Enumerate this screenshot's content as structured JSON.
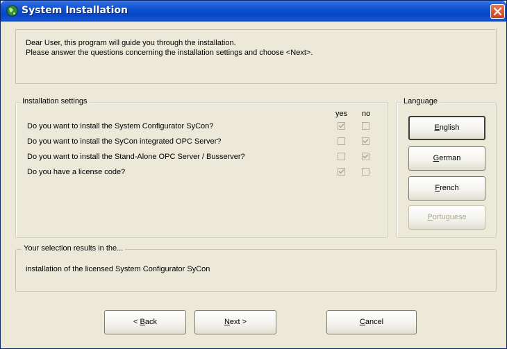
{
  "window": {
    "title": "System Installation",
    "icon": "globe-icon",
    "close_icon": "close-icon"
  },
  "intro": {
    "line1": "Dear User, this program will guide you through the installation.",
    "line2": "Please answer the questions concerning the installation settings and choose <Next>."
  },
  "settings": {
    "group_label": "Installation settings",
    "yes_header": "yes",
    "no_header": "no",
    "questions": [
      {
        "text": "Do you want to install the System Configurator SyCon?",
        "yes": true,
        "no": false
      },
      {
        "text": "Do you want to install the SyCon integrated OPC Server?",
        "yes": false,
        "no": true
      },
      {
        "text": "Do you want to install the Stand-Alone OPC Server / Busserver?",
        "yes": false,
        "no": true
      },
      {
        "text": "Do you have a license code?",
        "yes": true,
        "no": false
      }
    ]
  },
  "language": {
    "group_label": "Language",
    "buttons": [
      {
        "label": "English",
        "hotkey": "E",
        "rest": "nglish",
        "state": "selected"
      },
      {
        "label": "German",
        "hotkey": "G",
        "rest": "erman",
        "state": "enabled"
      },
      {
        "label": "French",
        "hotkey": "F",
        "rest": "rench",
        "state": "enabled"
      },
      {
        "label": "Portuguese",
        "hotkey": "P",
        "rest": "ortuguese",
        "state": "disabled"
      }
    ]
  },
  "result": {
    "group_label": "Your selection results in the...",
    "text": "installation of the licensed System Configurator SyCon"
  },
  "nav": {
    "back": {
      "prefix": "< ",
      "hotkey": "B",
      "rest": "ack"
    },
    "next": {
      "hotkey": "N",
      "rest": "ext >"
    },
    "cancel": {
      "hotkey": "C",
      "rest": "ancel"
    }
  },
  "colors": {
    "titlebar": "#0b4fd1",
    "dialog_bg": "#ece9d8",
    "close_button": "#c8431f"
  }
}
